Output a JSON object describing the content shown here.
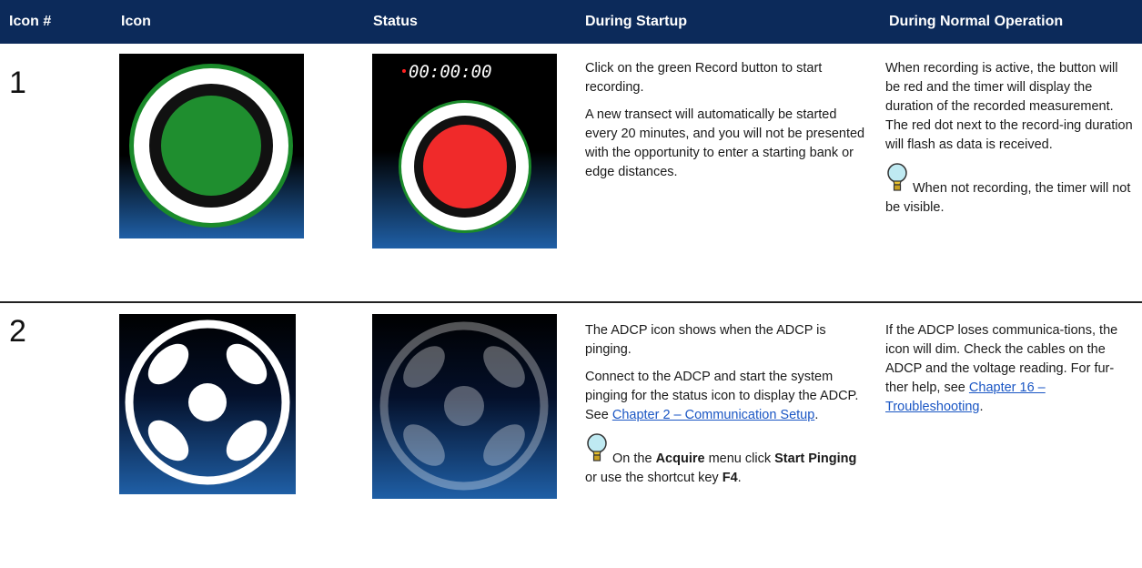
{
  "columns": [
    "Icon #",
    "Icon",
    "Status",
    "During Startup",
    "During Normal Operation"
  ],
  "colors": {
    "header_bg": "#0c2a5a",
    "link": "#1a56c4"
  },
  "rows": [
    {
      "number": "1",
      "icon_name": "record-button-green-icon",
      "status_icon_name": "record-button-red-timer-icon",
      "timer_text": "00:00:00",
      "startup": {
        "p1": "Click on the green Record button to start recording.",
        "p2": "A new transect will automatically be started every 20 minutes, and you will not be presented with the opportunity to enter a starting bank or edge distances."
      },
      "normal": {
        "p1": "When recording is active, the button will be red and the timer will display the duration of the recorded measurement. The red dot next to the record-ing duration will flash as data is received.",
        "tip": "When not recording, the timer will not be visible."
      }
    },
    {
      "number": "2",
      "icon_name": "adcp-transducer-icon",
      "status_icon_name": "adcp-transducer-dim-icon",
      "startup": {
        "p1": "The ADCP icon shows when the ADCP is pinging.",
        "p2_prefix": "Connect to the ADCP and start the system pinging for the status icon to display the ADCP. See ",
        "p2_link": "Chapter 2 – Communication Setup",
        "p2_suffix": ".",
        "tip_pre": "On the ",
        "tip_b1": "Acquire",
        "tip_mid": " menu click ",
        "tip_b2": "Start Pinging",
        "tip_mid2": " or use the shortcut key ",
        "tip_b3": "F4",
        "tip_end": "."
      },
      "normal": {
        "p_prefix": "If the ADCP loses communica-tions, the icon will dim. Check the cables on the ADCP and the voltage reading. For fur-ther help, see ",
        "link": "Chapter 16 – Troubleshooting",
        "suffix": "."
      }
    }
  ]
}
